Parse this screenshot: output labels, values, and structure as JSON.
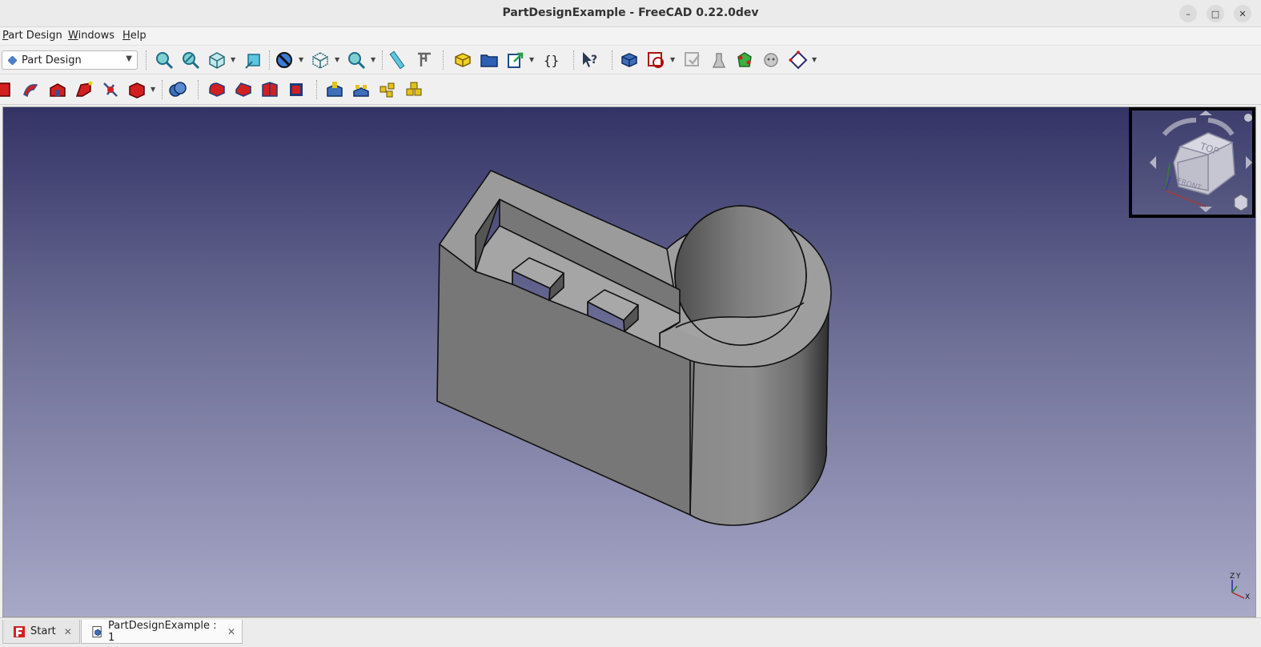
{
  "window": {
    "title": "PartDesignExample - FreeCAD 0.22.0dev"
  },
  "menu": {
    "items": [
      "Part Design",
      "Windows",
      "Help"
    ]
  },
  "toolbar": {
    "workbench": "Part Design"
  },
  "navcube": {
    "top_label": "TOP",
    "front_label": "FRONT"
  },
  "axis": {
    "z": "Z",
    "y": "Y",
    "x": "X"
  },
  "tabs": [
    {
      "label": "Start"
    },
    {
      "label": "PartDesignExample : 1"
    }
  ],
  "colors": {
    "bg_top": "#333366",
    "bg_bottom": "#a8a8c8",
    "solid_face": "#9a9a9a"
  }
}
